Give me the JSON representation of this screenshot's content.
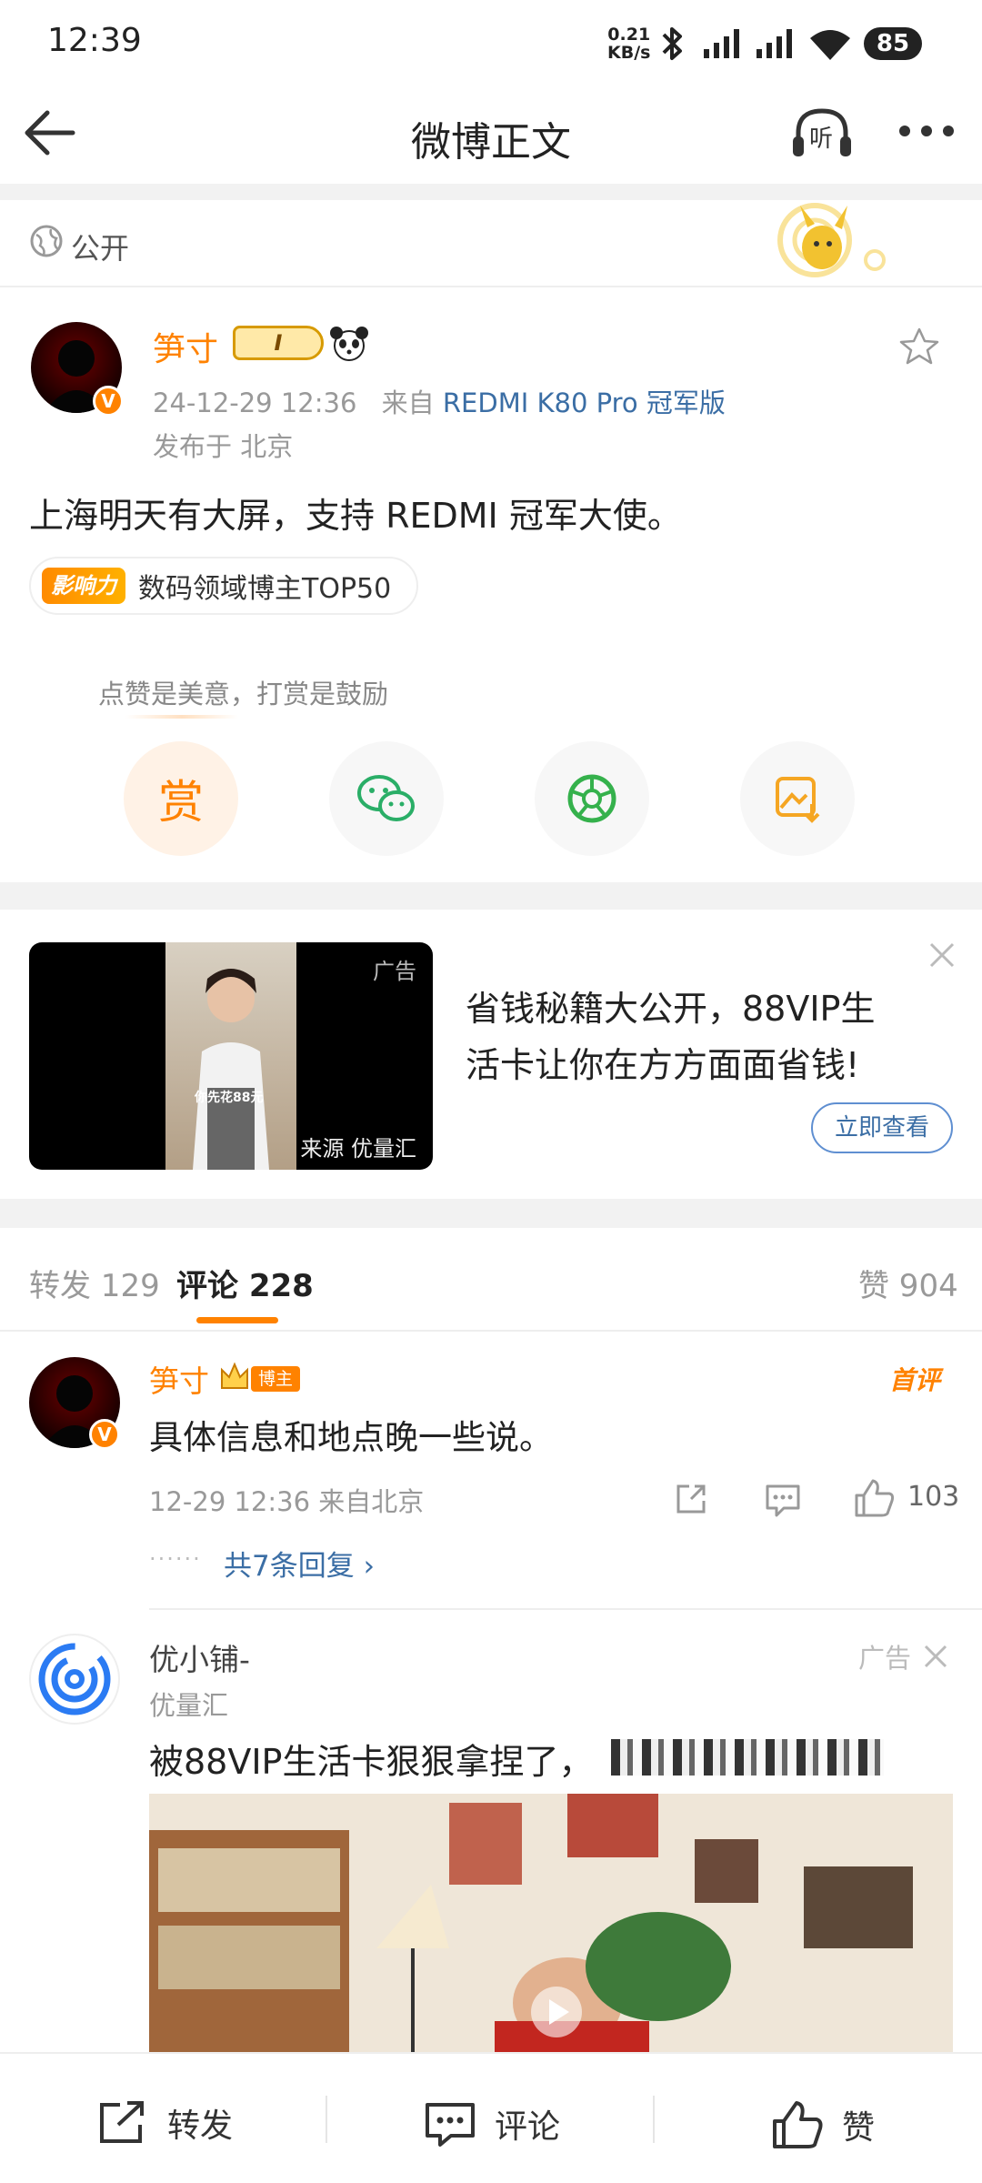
{
  "status_bar": {
    "time": "12:39",
    "net_speed_value": "0.21",
    "net_speed_unit": "KB/s",
    "battery": "85"
  },
  "header": {
    "title": "微博正文",
    "listen_label": "听"
  },
  "visibility": {
    "label": "公开"
  },
  "post": {
    "author": "笋寸",
    "level_badge": "I",
    "time": "24-12-29 12:36",
    "from_prefix": "来自",
    "source": "REDMI K80 Pro 冠军版",
    "location": "发布于 北京",
    "text": "上海明天有大屏，支持 REDMI 冠军大使。",
    "influence_badge": "影响力",
    "influence_text": "数码领域博主TOP50"
  },
  "reward": {
    "tip": "点赞是美意，打赏是鼓励",
    "reward_label": "赏"
  },
  "ad": {
    "tag": "广告",
    "source": "来源 优量汇",
    "thumb_caption": "你先花88元",
    "title": "省钱秘籍大公开，88VIP生活卡让你在方方面面省钱!",
    "cta": "立即查看"
  },
  "tabs": {
    "repost": "转发 129",
    "comments": "评论 228",
    "likes": "赞 904"
  },
  "comments": [
    {
      "author": "笋寸",
      "tag": "博主",
      "badge": "首评",
      "text": "具体信息和地点晚一些说。",
      "meta": "12-29 12:36  来自北京",
      "likes": "103",
      "replies": "共7条回复 ›",
      "dots": "······"
    }
  ],
  "ad_comment": {
    "name": "优小铺-",
    "source": "优量汇",
    "tag": "广告",
    "text": "被88VIP生活卡狠狠拿捏了，"
  },
  "bottom_bar": {
    "repost": "转发",
    "comment": "评论",
    "like": "赞"
  }
}
